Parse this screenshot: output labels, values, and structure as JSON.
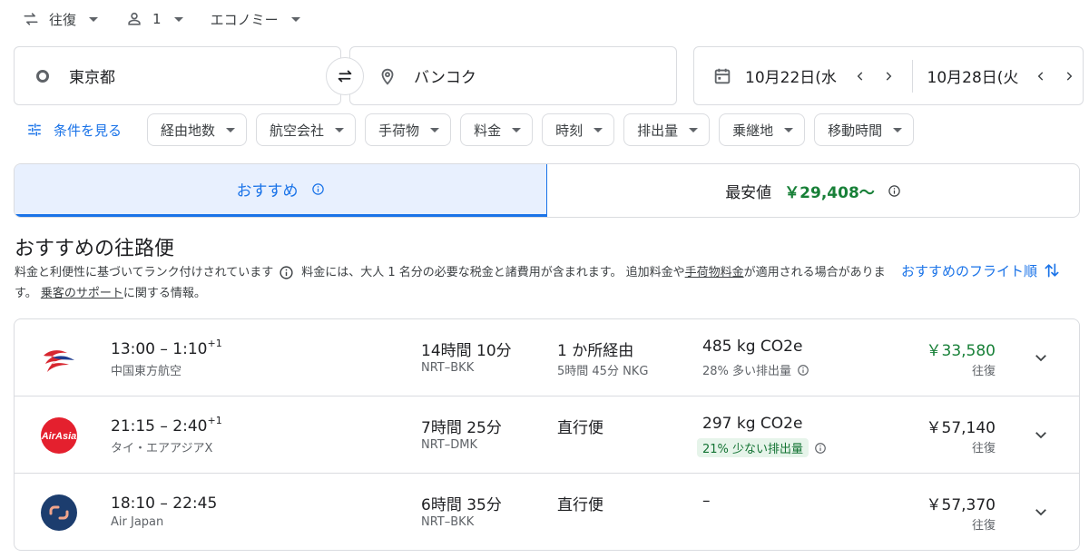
{
  "search_options": {
    "trip_type": "往復",
    "passengers": "1",
    "cabin_class": "エコノミー"
  },
  "search": {
    "origin": "東京都",
    "destination": "バンコク",
    "depart_date": "10月22日(水",
    "return_date": "10月28日(火"
  },
  "filters": {
    "all_filters_label": "条件を見る",
    "chips": [
      "経由地数",
      "航空会社",
      "手荷物",
      "料金",
      "時刻",
      "排出量",
      "乗継地",
      "移動時間"
    ]
  },
  "tabs": {
    "best_label": "おすすめ",
    "cheapest_label": "最安値",
    "cheapest_price": "￥29,408～"
  },
  "results": {
    "title": "おすすめの往路便",
    "info_part1": "料金と利便性に基づいてランク付けされています",
    "info_part2": "料金には、大人 1 名分の必要な税金と諸費用が含まれます。 追加料金や",
    "baggage_fees_link": "手荷物料金",
    "info_part3": "が適用される場合があります。",
    "passenger_help_link": "乗客のサポート",
    "info_part4": "に関する情報。",
    "sort_label": "おすすめのフライト順"
  },
  "flights": [
    {
      "times": "13:00 – 1:10",
      "day_offset": "+1",
      "airline": "中国東方航空",
      "duration": "14時間 10分",
      "route": "NRT–BKK",
      "stops": "1 か所経由",
      "stop_detail": "5時間 45分 NKG",
      "co2": "485 kg CO2e",
      "emissions": "28% 多い排出量",
      "price": "￥33,580",
      "price_type": "往復"
    },
    {
      "times": "21:15 – 2:40",
      "day_offset": "+1",
      "airline": "タイ・エアアジアX",
      "duration": "7時間 25分",
      "route": "NRT–DMK",
      "stops": "直行便",
      "stop_detail": "",
      "co2": "297 kg CO2e",
      "emissions": "21% 少ない排出量",
      "price": "￥57,140",
      "price_type": "往復"
    },
    {
      "times": "18:10 – 22:45",
      "day_offset": "",
      "airline": "Air Japan",
      "duration": "6時間 35分",
      "route": "NRT–BKK",
      "stops": "直行便",
      "stop_detail": "",
      "co2": "–",
      "emissions": "",
      "price": "￥57,370",
      "price_type": "往復"
    }
  ],
  "colors": {
    "accent": "#1a73e8",
    "price_green": "#188038",
    "border": "#dadce0",
    "active_tab_bg": "#e8f0fe"
  },
  "icons": {
    "trip_type": "swap-arrows-icon",
    "passengers": "person-icon",
    "origin": "circle-icon",
    "destination": "location-pin-icon",
    "swap": "swap-icon",
    "calendar": "calendar-icon",
    "filters": "tune-icon",
    "info": "info-icon",
    "sort": "sort-icon",
    "expand": "chevron-down-icon"
  }
}
